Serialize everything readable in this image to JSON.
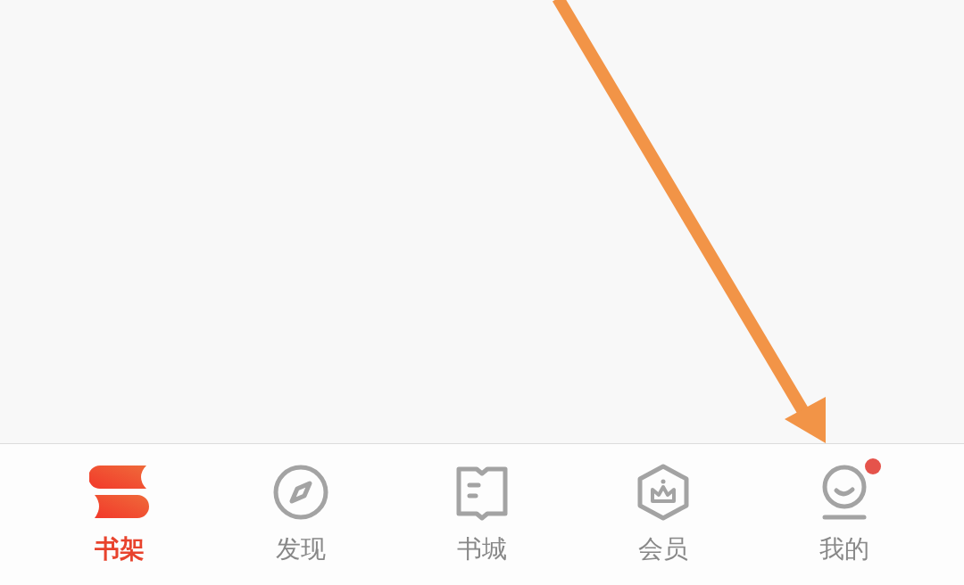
{
  "tabs": [
    {
      "label": "书架",
      "kind": "shelf",
      "selected": true,
      "dot": false
    },
    {
      "label": "发现",
      "kind": "discover",
      "selected": false,
      "dot": false
    },
    {
      "label": "书城",
      "kind": "store",
      "selected": false,
      "dot": false
    },
    {
      "label": "会员",
      "kind": "member",
      "selected": false,
      "dot": false
    },
    {
      "label": "我的",
      "kind": "me",
      "selected": false,
      "dot": true
    }
  ]
}
